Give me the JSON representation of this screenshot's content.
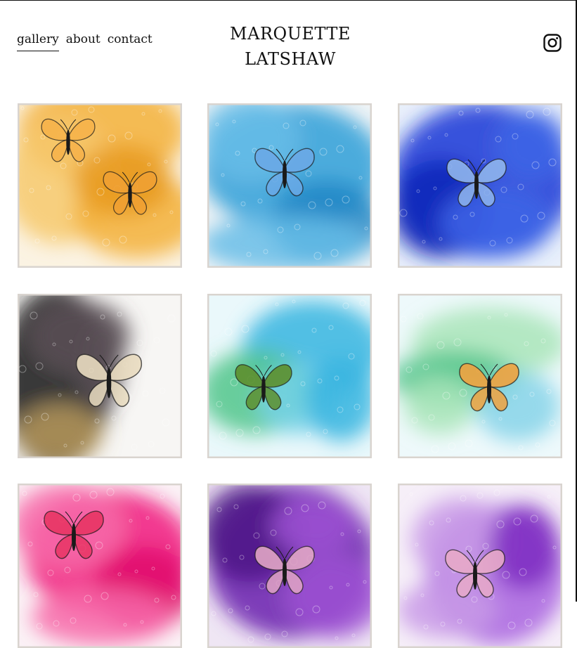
{
  "nav": {
    "items": [
      {
        "label": "gallery",
        "active": true
      },
      {
        "label": "about",
        "active": false
      },
      {
        "label": "contact",
        "active": false
      }
    ]
  },
  "brand": {
    "line1": "MARQUETTE",
    "line2": "LATSHAW"
  },
  "social": {
    "icon": "instagram-icon"
  },
  "gallery": {
    "tiles": [
      {
        "palette": [
          "#fbf3e3",
          "#f3b03a",
          "#f7c96c",
          "#e89a1f"
        ],
        "butterflies": [
          "#f6b24a",
          "#f0a033"
        ]
      },
      {
        "palette": [
          "#f1f4f6",
          "#2f9fd8",
          "#67bde8",
          "#1d86c4"
        ],
        "butterflies": [
          "#6aa9e6"
        ]
      },
      {
        "palette": [
          "#e9f0fb",
          "#1437d6",
          "#3f66e8",
          "#0a24b8"
        ],
        "butterflies": [
          "#8fb5ec"
        ]
      },
      {
        "palette": [
          "#f7f6f4",
          "#1a1617",
          "#5b5056",
          "#b79a5c"
        ],
        "butterflies": [
          "#e9dcc0"
        ]
      },
      {
        "palette": [
          "#eaf8fb",
          "#37b5e0",
          "#52c58b",
          "#77d2ea"
        ],
        "butterflies": [
          "#5d8f2e"
        ]
      },
      {
        "palette": [
          "#eef9fb",
          "#86d3e9",
          "#54c58c",
          "#a9e5b9"
        ],
        "butterflies": [
          "#f0a23f"
        ]
      },
      {
        "palette": [
          "#fbf2f6",
          "#f0197e",
          "#f76aa9",
          "#e0086c"
        ],
        "butterflies": [
          "#e83564"
        ]
      },
      {
        "palette": [
          "#efe6f4",
          "#6a1fae",
          "#9d52d3",
          "#4c1486"
        ],
        "butterflies": [
          "#e0a5c4"
        ]
      },
      {
        "palette": [
          "#f6eff8",
          "#a963df",
          "#c99be8",
          "#7e2bc2"
        ],
        "butterflies": [
          "#e7a9c8"
        ]
      }
    ]
  }
}
